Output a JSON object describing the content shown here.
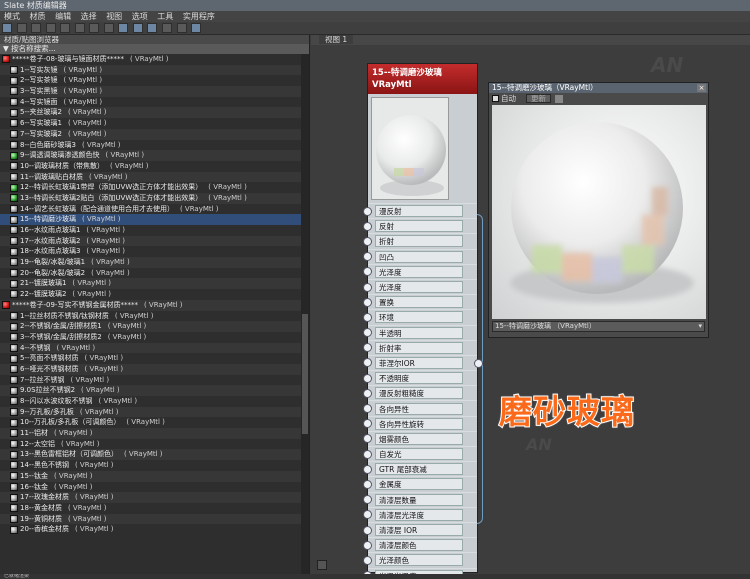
{
  "window": {
    "title": "Slate 材质编辑器"
  },
  "menu": [
    "模式",
    "材质",
    "编辑",
    "选择",
    "视图",
    "选项",
    "工具",
    "实用程序"
  ],
  "browser": {
    "header": "材质/贴图浏览器",
    "search_label": "▼ 按名称搜索...",
    "items": [
      {
        "name": "*****卷子-08-玻璃与镜面材质*****",
        "type": "( VRayMtl )",
        "kind": "group",
        "sw": "red"
      },
      {
        "name": "1--写实灰镜",
        "type": "( VRayMtl )",
        "kind": "item",
        "sw": "white"
      },
      {
        "name": "2--写实茶镜",
        "type": "( VRayMtl )",
        "kind": "item",
        "sw": "white"
      },
      {
        "name": "3--写实黑镜",
        "type": "( VRayMtl )",
        "kind": "item",
        "sw": "white"
      },
      {
        "name": "4--写实镜面",
        "type": "( VRayMtl )",
        "kind": "item",
        "sw": "white"
      },
      {
        "name": "5--夹丝玻璃2",
        "type": "( VRayMtl )",
        "kind": "item",
        "sw": "white"
      },
      {
        "name": "6--写实玻璃1",
        "type": "( VRayMtl )",
        "kind": "item",
        "sw": "white"
      },
      {
        "name": "7--写实玻璃2",
        "type": "( VRayMtl )",
        "kind": "item",
        "sw": "white"
      },
      {
        "name": "8--白色磨砂玻璃3",
        "type": "( VRayMtl )",
        "kind": "item",
        "sw": "white"
      },
      {
        "name": "9--调透调玻璃渗透颜色快",
        "type": "( VRayMtl )",
        "kind": "item",
        "sw": "green"
      },
      {
        "name": "10--调玻璃材质（带焦散）",
        "type": "( VRayMtl )",
        "kind": "item",
        "sw": "white"
      },
      {
        "name": "11--调玻璃贴白材质",
        "type": "( VRayMtl )",
        "kind": "item",
        "sw": "white"
      },
      {
        "name": "12--特调长虹玻璃1带焊（添加UVW选正方体才能出效果）",
        "type": "( VRayMtl )",
        "kind": "item",
        "sw": "green"
      },
      {
        "name": "13--特调长虹玻璃2贴白（添加UVW选正方体才能出效果）",
        "type": "( VRayMtl )",
        "kind": "item",
        "sw": "green"
      },
      {
        "name": "14--调艺长虹玻璃（配合通道使用合用才去使用）",
        "type": "( VRayMtl )",
        "kind": "item",
        "sw": "white"
      },
      {
        "name": "15--特调磨沙玻璃",
        "type": "( VRayMtl )",
        "kind": "item",
        "sw": "white",
        "selected": true
      },
      {
        "name": "16--水纹雨点玻璃1",
        "type": "( VRayMtl )",
        "kind": "item",
        "sw": "white"
      },
      {
        "name": "17--水纹雨点玻璃2",
        "type": "( VRayMtl )",
        "kind": "item",
        "sw": "white"
      },
      {
        "name": "18--水纹雨点玻璃3",
        "type": "( VRayMtl )",
        "kind": "item",
        "sw": "white"
      },
      {
        "name": "19--龟裂/冰裂/玻璃1",
        "type": "( VRayMtl )",
        "kind": "item",
        "sw": "white"
      },
      {
        "name": "20--龟裂/冰裂/玻璃2",
        "type": "( VRayMtl )",
        "kind": "item",
        "sw": "white"
      },
      {
        "name": "21--镀膜玻璃1",
        "type": "( VRayMtl )",
        "kind": "item",
        "sw": "white"
      },
      {
        "name": "22--镀膜玻璃2",
        "type": "( VRayMtl )",
        "kind": "item",
        "sw": "white"
      },
      {
        "name": "*****卷子-09-写实不锈钢金属材质*****",
        "type": "( VRayMtl )",
        "kind": "group",
        "sw": "red"
      },
      {
        "name": "1--拉丝材质不锈钢/钛钢材质",
        "type": "( VRayMtl )",
        "kind": "item",
        "sw": "white"
      },
      {
        "name": "2--不锈钢/金属/刮擦材质1",
        "type": "( VRayMtl )",
        "kind": "item",
        "sw": "white"
      },
      {
        "name": "3--不锈钢/金属/刮擦材质2",
        "type": "( VRayMtl )",
        "kind": "item",
        "sw": "white"
      },
      {
        "name": "4--不锈钢",
        "type": "( VRayMtl )",
        "kind": "item",
        "sw": "white"
      },
      {
        "name": "5--亮面不锈钢材质",
        "type": "( VRayMtl )",
        "kind": "item",
        "sw": "white"
      },
      {
        "name": "6--哑光不锈钢材质",
        "type": "( VRayMtl )",
        "kind": "item",
        "sw": "white"
      },
      {
        "name": "7--拉丝不锈钢",
        "type": "( VRayMtl )",
        "kind": "item",
        "sw": "white"
      },
      {
        "name": "9.0S拉丝不锈钢2",
        "type": "( VRayMtl )",
        "kind": "item",
        "sw": "white"
      },
      {
        "name": "8--闪以水波纹板不锈钢",
        "type": "( VRayMtl )",
        "kind": "item",
        "sw": "white"
      },
      {
        "name": "9--万孔板/多孔板",
        "type": "( VRayMtl )",
        "kind": "item",
        "sw": "white"
      },
      {
        "name": "10--万孔板/多孔板（可调颜色）",
        "type": "( VRayMtl )",
        "kind": "item",
        "sw": "white"
      },
      {
        "name": "11--铝材",
        "type": "( VRayMtl )",
        "kind": "item",
        "sw": "white"
      },
      {
        "name": "12--太空铝",
        "type": "( VRayMtl )",
        "kind": "item",
        "sw": "white"
      },
      {
        "name": "13--黑色雷框铝材（可调颜色）",
        "type": "( VRayMtl )",
        "kind": "item",
        "sw": "white"
      },
      {
        "name": "14--黑色不锈钢",
        "type": "( VRayMtl )",
        "kind": "item",
        "sw": "white"
      },
      {
        "name": "15--钛金",
        "type": "( VRayMtl )",
        "kind": "item",
        "sw": "white"
      },
      {
        "name": "16--钛金",
        "type": "( VRayMtl )",
        "kind": "item",
        "sw": "white"
      },
      {
        "name": "17--玫瑰金材质",
        "type": "( VRayMtl )",
        "kind": "item",
        "sw": "white"
      },
      {
        "name": "18--黄金材质",
        "type": "( VRayMtl )",
        "kind": "item",
        "sw": "white"
      },
      {
        "name": "19--黄铜材质",
        "type": "( VRayMtl )",
        "kind": "item",
        "sw": "white"
      },
      {
        "name": "20--香槟金材质",
        "type": "( VRayMtl )",
        "kind": "item",
        "sw": "white"
      }
    ]
  },
  "view": {
    "tab": "视图 1"
  },
  "node": {
    "title": "15--特调磨沙玻璃",
    "subtitle": "VRayMtl",
    "slots": [
      "漫反射",
      "反射",
      "折射",
      "凹凸",
      "光泽度",
      "光泽度",
      "置换",
      "环境",
      "半透明",
      "折射率",
      "菲涅尔IOR",
      "不透明度",
      "漫反射粗糙度",
      "各向异性",
      "各向异性旋转",
      "烟雾颜色",
      "自发光",
      "GTR 尾部衰减",
      "金属度",
      "清漆层数量",
      "清漆层光泽度",
      "清漆层 IOR",
      "清漆层颜色",
      "光泽颜色",
      "光泽光泽度"
    ]
  },
  "preview_window": {
    "title": "15--特调磨沙玻璃（VRayMtl）",
    "auto_label": "自动",
    "update_label": "更新",
    "selector_value": "15--特调磨沙玻璃 （VRayMtl）"
  },
  "overlay_text": "磨砂玻璃",
  "status": "已就绪渲染"
}
